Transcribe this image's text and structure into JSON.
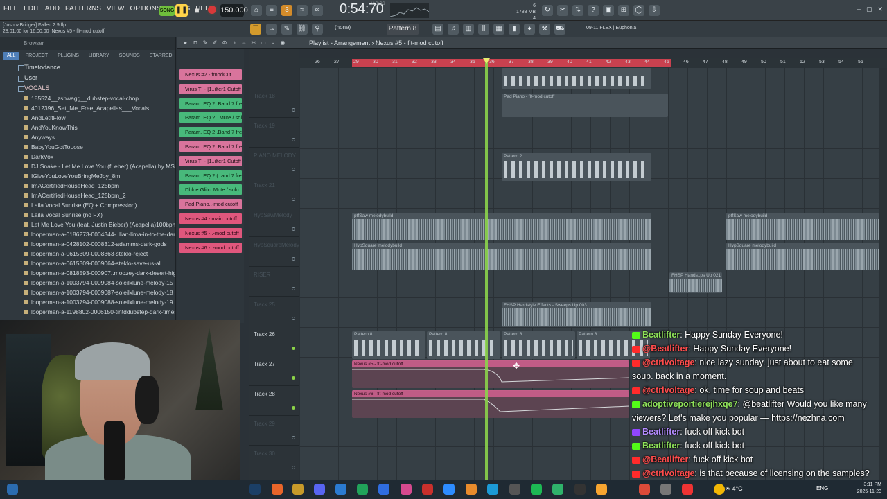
{
  "menu": [
    "FILE",
    "EDIT",
    "ADD",
    "PATTERNS",
    "VIEW",
    "OPTIONS",
    "TOOLS",
    "HELP"
  ],
  "transport": {
    "song_label": "SONG",
    "tempo": "150.000",
    "time": "0:54:70",
    "time_unit": "M:S:CS",
    "memory": "1788 MB",
    "memory_sub": "4",
    "cpu_count": "6"
  },
  "bar2": {
    "user": "[JoshuaBridger] Fallen 2.9.flp",
    "time_range": "28:01:00 for 16:00:00",
    "hint": "Nexus #5 - flt-mod cutoff",
    "none_sel": "(none)",
    "pattern": "Pattern 8",
    "plugin": "09-11  FLEX | Euphonia"
  },
  "browser": {
    "title": "Browser",
    "tabs": [
      "ALL",
      "PROJECT",
      "PLUGINS",
      "LIBRARY",
      "SOUNDS",
      "STARRED"
    ],
    "folders": [
      "Timetodance",
      "User",
      "VOCALS"
    ],
    "files": [
      "185524__zshwagg__dubstep-vocal-chop",
      "4012396_Set_Me_Free_Acapellas___Vocals",
      "AndLetItFlow",
      "AndYouKnowThis",
      "Anyways",
      "BabyYouGotToLose",
      "DarkVox",
      "DJ Snake - Let Me Love You (f..eber) (Acapella) by MS Project",
      "IGiveYouLoveYouBringMeJoy_8m",
      "ImACertifiedHouseHead_125bpm",
      "ImACertifiedHouseHead_125bpm_2",
      "Laila Vocal Sunrise (EQ + Compression)",
      "Laila Vocal Sunrise (no FX)",
      "Let Me Love You (feat. Justin Bieber) (Acapella)100bpm Wav",
      "looperman-a-0186273-0004344-..lian-lima-in-to-the-dark-sky",
      "looperman-a-0428102-0008312-adamms-dark-gods",
      "looperman-a-0615309-0008363-steklo-reject",
      "looperman-a-0615309-0009064-steklo-save-us-all",
      "looperman-a-0818593-000907..moozey-dark-desert-highway",
      "looperman-a-1003794-0009084-soleilxlune-melody-15",
      "looperman-a-1003794-0009087-soleilxlune-melody-18",
      "looperman-a-1003794-0009088-soleilxlune-melody-19",
      "looperman-a-1198802-0006150-tintddubstep-dark-times"
    ]
  },
  "channels": [
    {
      "label": "Nexus #2 - fmodCut",
      "style": "plain"
    },
    {
      "label": "Virus TI - [1..ilter1 Cutoff",
      "style": "plain"
    },
    {
      "label": "Param. EQ 2..Band 7 freq",
      "style": "green"
    },
    {
      "label": "Param. EQ 2...Mute / solo",
      "style": "green"
    },
    {
      "label": "Param. EQ 2..Band 7 freq",
      "style": "green"
    },
    {
      "label": "Param. EQ 2..Band 7 freq",
      "style": "plain"
    },
    {
      "label": "Virus TI - [1..ilter1 Cutoff",
      "style": "plain"
    },
    {
      "label": "Param. EQ 2 (..and 7 freq",
      "style": "green"
    },
    {
      "label": "Dblue Glitc..Mute / solo",
      "style": "green"
    },
    {
      "label": "Pad Piano..-mod cutoff",
      "style": "plain"
    },
    {
      "label": "Nexus #4 - main cutoff",
      "style": "pink"
    },
    {
      "label": "Nexus #5 -..-mod cutoff",
      "style": "pink"
    },
    {
      "label": "Nexus #6 -..-mod cutoff",
      "style": "pink"
    }
  ],
  "playlist": {
    "title": "Playlist - Arrangement",
    "crumb": "Nexus #5 - flt-mod cutoff",
    "ruler": [
      "26",
      "27",
      "29",
      "30",
      "31",
      "32",
      "33",
      "34",
      "35",
      "36",
      "37",
      "38",
      "39",
      "40",
      "41",
      "42",
      "43",
      "44",
      "45",
      "46",
      "47",
      "48",
      "49",
      "50",
      "51",
      "52",
      "53",
      "54",
      "55"
    ],
    "tracks": [
      "Track 18",
      "Track 19",
      "PIANO MELODY",
      "Track 21",
      "HypSawMelody",
      "HypSquareMelody",
      "RISER",
      "Track 25",
      "Track 26",
      "Track 27",
      "Track 28",
      "Track 29",
      "Track 30"
    ],
    "clips": {
      "pad": "Pad Piano - flt-mod cutoff",
      "pattern2": "Pattern 2",
      "saw": "ptfSaw melodybuild",
      "square": "HypSquare melodybuild",
      "fhsp": "FHSP Hands..ps Up 021",
      "fhsp2": "FHSP Hardstyle Effects - Sweeps Up 003",
      "pattern8": "Pattern 8",
      "auto5": "Nexus #5 - flt-mod cutoff",
      "auto6": "Nexus #6 - flt-mod cutoff"
    }
  },
  "chat": [
    {
      "badge": "kick",
      "name": "Beatlifter",
      "text": "Happy Sunday Everyone!"
    },
    {
      "badge": "yt",
      "name": "@Beatlifter",
      "text": "Happy Sunday Everyone!"
    },
    {
      "badge": "yt",
      "name": "@ctrlvoltage",
      "text": "nice lazy sunday. just about to eat some"
    },
    {
      "badge": "none",
      "name": "",
      "text": "soup. back in a moment."
    },
    {
      "badge": "yt",
      "name": "@ctrlvoltage",
      "text": "ok, time for soup and beats"
    },
    {
      "badge": "kick",
      "name": "adoptiveportierejhxqe7",
      "text": "@beatlifter Would you like many"
    },
    {
      "badge": "none",
      "name": "",
      "text": "viewers? Let's make you popular — https://nezhna.com"
    },
    {
      "badge": "tw",
      "name": "Beatlifter",
      "text": "fuck off kick bot"
    },
    {
      "badge": "kick",
      "name": "Beatlifter",
      "text": "fuck off kick bot"
    },
    {
      "badge": "yt",
      "name": "@Beatlifter",
      "text": "fuck off kick bot"
    },
    {
      "badge": "yt",
      "name": "@ctrlvoltage",
      "text": "is that because of licensing on the samples?"
    }
  ],
  "taskbar": {
    "weather": "4°C",
    "lang": "ENG",
    "clock": "3:11 PM",
    "date": "2025-11-23"
  },
  "colors": {
    "playhead": "#8bd34a",
    "ruler_loop": "#c9414f",
    "auto_clip": "#c05c86"
  }
}
